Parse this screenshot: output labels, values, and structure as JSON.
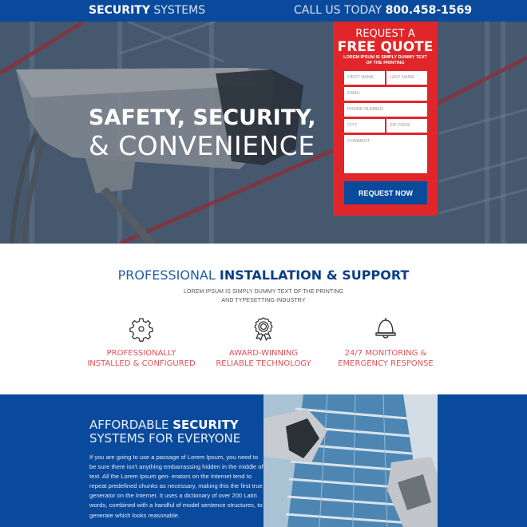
{
  "header": {
    "brand_bold": "SECURITY",
    "brand_light": "SYSTEMS",
    "call_label": "CALL US TODAY",
    "phone": "800.458-1569"
  },
  "hero": {
    "title_line1": "SAFETY, SECURITY,",
    "title_line2": "& CONVENIENCE"
  },
  "quote_form": {
    "heading_light": "REQUEST A",
    "heading_bold": "FREE QUOTE",
    "subheading": "LOREM IPSUM IS SIMPLY DUMMY TEXT OF THE PRINTING",
    "fields": {
      "first_name": "FIRST NAME",
      "last_name": "LAST NAME",
      "email": "EMAIL",
      "phone": "PHONE NUMBER",
      "city": "CITY",
      "zip": "ZIP CODE",
      "comment": "COMMENT"
    },
    "submit_label": "REQUEST NOW"
  },
  "features": {
    "title_light": "PROFESSIONAL",
    "title_bold": "INSTALLATION & SUPPORT",
    "subtitle_line1": "LOREM IPSUM IS SIMPLY DUMMY TEXT OF THE PRINTING",
    "subtitle_line2": "AND TYPESETTING INDUSTRY",
    "items": [
      {
        "icon": "gear-icon",
        "line1": "PROFESSIONALLY",
        "line2": "INSTALLED & CONFIGURED"
      },
      {
        "icon": "award-ribbon-icon",
        "line1": "AWARD-WINNING",
        "line2": "RELIABLE TECHNOLOGY"
      },
      {
        "icon": "bell-icon",
        "line1": "24/7 MONITORING &",
        "line2": "EMERGENCY RESPONSE"
      }
    ]
  },
  "affordable": {
    "title_light": "AFFORDABLE",
    "title_bold": "SECURITY",
    "title_line2": "SYSTEMS FOR EVERYONE",
    "body": "If you are going to use a passage of Lorem Ipsum, you need to be sure there isn't anything embarrassing hidden in the middle of text. All the Lorem Ipsum gen- erators on the Internet tend to repeat predefined chunks as necessary, making this the first true generator on the Internet. It uses a dictionary of over 200 Latin words, combined with a handful of model sentence structures, to generate which looks reasonable."
  },
  "colors": {
    "brand_blue": "#0a4a9c",
    "accent_red": "#e0262a",
    "feature_text": "#e05257"
  }
}
